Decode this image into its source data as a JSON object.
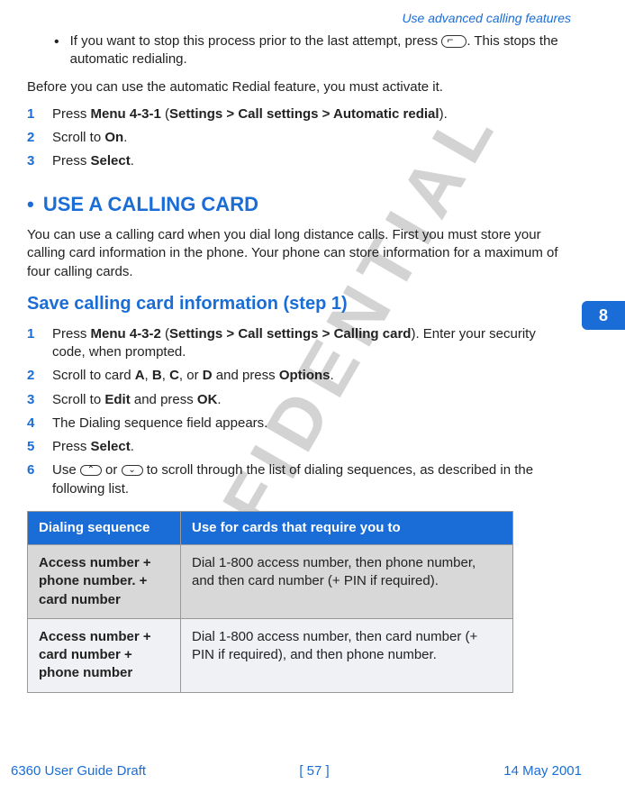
{
  "header": {
    "section_title": "Use advanced calling features"
  },
  "chapter_tab": "8",
  "watermark": "CONFIDENTIAL",
  "intro_bullet": {
    "pre": "If you want to stop this process prior to the last attempt, press ",
    "post": ". This stops the automatic redialing."
  },
  "before_text": "Before you can use the automatic Redial feature, you must activate it.",
  "redial_steps": [
    {
      "n": "1",
      "pre": "Press ",
      "bold1": "Menu 4-3-1",
      "mid": " (",
      "bold2": "Settings > Call settings > Automatic redial",
      "post": ")."
    },
    {
      "n": "2",
      "pre": "Scroll to ",
      "bold1": "On",
      "mid": "",
      "bold2": "",
      "post": "."
    },
    {
      "n": "3",
      "pre": "Press ",
      "bold1": "Select",
      "mid": "",
      "bold2": "",
      "post": "."
    }
  ],
  "section2": {
    "bullet": "•",
    "title": "USE A CALLING CARD",
    "para": "You can use a calling card when you dial long distance calls. First you must store your calling card information in the phone. Your phone can store information for a maximum of four calling cards."
  },
  "subsection": "Save calling card information (step 1)",
  "cc_steps": {
    "s1": {
      "n": "1",
      "pre": "Press ",
      "b1": "Menu 4-3-2",
      "mid": " (",
      "b2": "Settings > Call settings > Calling card",
      "post": "). Enter your security code, when prompted."
    },
    "s2": {
      "n": "2",
      "pre": "Scroll to card ",
      "a": "A",
      "b": "B",
      "c": "C",
      "d": "D",
      "mid": ", ",
      "or": ", or ",
      "andpress": " and press ",
      "opt": "Options",
      "dot": "."
    },
    "s3": {
      "n": "3",
      "pre": "Scroll to ",
      "b1": "Edit",
      "mid": " and press ",
      "b2": "OK",
      "post": "."
    },
    "s4": {
      "n": "4",
      "text": "The Dialing sequence field appears."
    },
    "s5": {
      "n": "5",
      "pre": "Press ",
      "b1": "Select",
      "post": "."
    },
    "s6": {
      "n": "6",
      "pre": "Use ",
      "mid": " or ",
      "post": " to scroll through the list of dialing sequences, as described in the following list."
    }
  },
  "table": {
    "h1": "Dialing sequence",
    "h2": "Use for cards that require you to",
    "r1c1": "Access number + phone number. + card number",
    "r1c2": "Dial 1-800 access number, then phone number, and then card number (+ PIN if required).",
    "r2c1": "Access number + card number + phone number",
    "r2c2": "Dial 1-800 access number, then card number (+ PIN if required), and then phone number."
  },
  "footer": {
    "left": "6360 User Guide Draft",
    "center": "[ 57 ]",
    "right": "14 May 2001"
  }
}
